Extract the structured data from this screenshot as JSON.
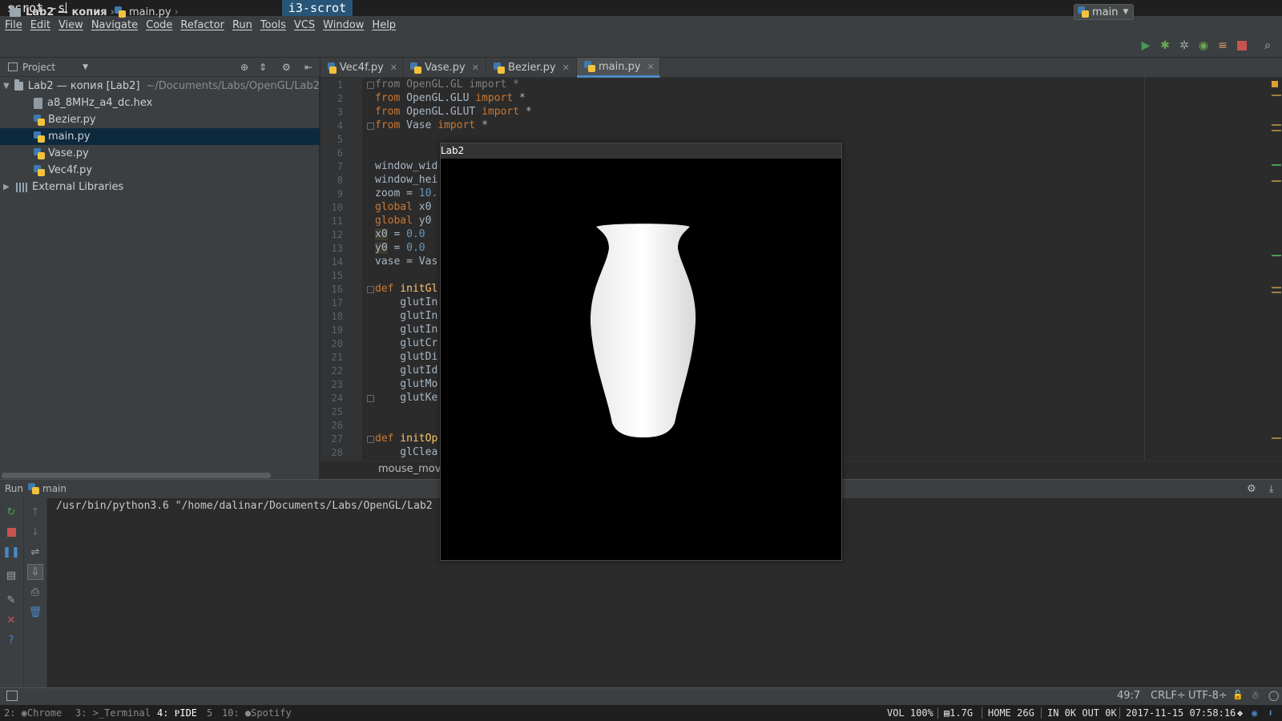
{
  "i3": {
    "command_text": "scrot -s",
    "mode_label": "i3-scrot",
    "workspaces": [
      {
        "num": "2:",
        "name": "Chrome"
      },
      {
        "num": "3:",
        "name": ">_Terminal"
      },
      {
        "num": "4:",
        "name": "IDE"
      },
      {
        "num": "5",
        "name": ""
      },
      {
        "num": "10:",
        "name": "Spotify"
      }
    ],
    "status": {
      "volume": "VOL 100%",
      "memory": "1.7G",
      "home": "HOME 26G",
      "net": "IN 0K OUT 0K",
      "datetime": "2017-11-15 07:58:16"
    }
  },
  "menu": [
    "File",
    "Edit",
    "View",
    "Navigate",
    "Code",
    "Refactor",
    "Run",
    "Tools",
    "VCS",
    "Window",
    "Help"
  ],
  "navbar": {
    "project_crumb": "Lab2 — копия",
    "file_crumb": "main.py",
    "run_config": "main"
  },
  "project": {
    "header_label": "Project",
    "root_name": "Lab2 — копия [Lab2]",
    "root_path": "~/Documents/Labs/OpenGL/Lab2",
    "files": [
      "a8_8MHz_a4_dc.hex",
      "Bezier.py",
      "main.py",
      "Vase.py",
      "Vec4f.py"
    ],
    "selected_file": "main.py",
    "external_libraries": "External Libraries"
  },
  "tabs": [
    "Vec4f.py",
    "Vase.py",
    "Bezier.py",
    "main.py"
  ],
  "active_tab": "main.py",
  "editor": {
    "line_numbers": [
      "1",
      "2",
      "3",
      "4",
      "5",
      "6",
      "7",
      "8",
      "9",
      "10",
      "11",
      "12",
      "13",
      "14",
      "15",
      "16",
      "17",
      "18",
      "19",
      "20",
      "21",
      "22",
      "23",
      "24",
      "25",
      "26",
      "27",
      "28"
    ],
    "lines": {
      "l1": "from OpenGL.GL import *",
      "l2a": "from",
      "l2b": " OpenGL.GLU ",
      "l2c": "import",
      "l2d": " *",
      "l3a": "from",
      "l3b": " OpenGL.GLUT ",
      "l3c": "import",
      "l3d": " *",
      "l4a": "from",
      "l4b": " Vase ",
      "l4c": "import",
      "l4d": " *",
      "l7": "window_wid",
      "l8": "window_hei",
      "l9a": "zoom = ",
      "l9b": "10.",
      "l10a": "global",
      "l10b": " x0",
      "l11a": "global",
      "l11b": " y0",
      "l12a": "x0",
      "l12b": " = ",
      "l12c": "0.0",
      "l13a": "y0",
      "l13b": " = ",
      "l13c": "0.0",
      "l14": "vase = Vas",
      "l16a": "def",
      "l16b": " initGl",
      "l17": "    glutIn",
      "l18": "    glutIn",
      "l19": "    glutIn",
      "l20": "    glutCr",
      "l21": "    glutDi",
      "l22": "    glutId",
      "l23": "    glutMo",
      "l24": "    glutKe",
      "l27a": "def",
      "l27b": " initOp",
      "l28": "    glClea"
    },
    "breadcrumb": "mouse_mov"
  },
  "run_panel": {
    "label": "Run",
    "config": "main",
    "command": "/usr/bin/python3.6 \"/home/dalinar/Documents/Labs/OpenGL/Lab2"
  },
  "statusbar": {
    "position": "49:7",
    "line_sep": "CRLF",
    "encoding": "UTF-8"
  },
  "gl_window": {
    "title": "Lab2"
  },
  "colors": {
    "accent": "#4a88c7",
    "i3_focus": "#285577",
    "run_green": "#499c54",
    "stop_red": "#c75450"
  }
}
